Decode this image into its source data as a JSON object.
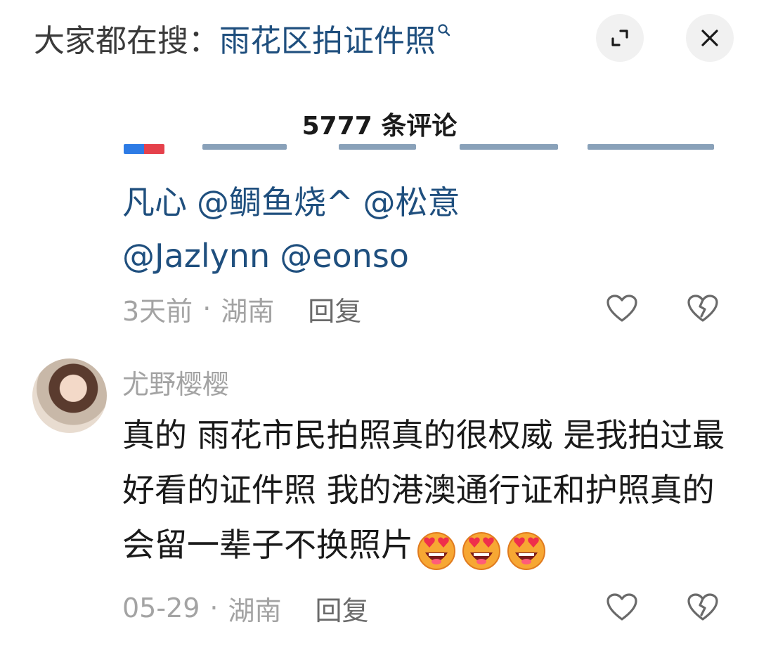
{
  "header": {
    "search_prefix": "大家都在搜：",
    "search_term": "雨花区拍证件照"
  },
  "comment_count": "5777 条评论",
  "previous_comment": {
    "mentions": [
      "凡心",
      "@鲷鱼烧^",
      "@松意",
      "@Jazlynn",
      "@eonso"
    ],
    "time": "3天前",
    "location": "湖南",
    "reply_label": "回复"
  },
  "comment": {
    "username": "尤野樱樱",
    "text": "真的 雨花市民拍照真的很权威 是我拍过最好看的证件照 我的港澳通行证和护照真的会留一辈子不换照片",
    "emoji": [
      "heart-eyes-emoji",
      "heart-eyes-emoji",
      "heart-eyes-emoji"
    ],
    "time": "05-29",
    "location": "湖南",
    "reply_label": "回复"
  },
  "colors": {
    "link_blue": "#1f4f7e",
    "meta_gray": "#a3a3a3",
    "text": "#1a1a1a"
  }
}
